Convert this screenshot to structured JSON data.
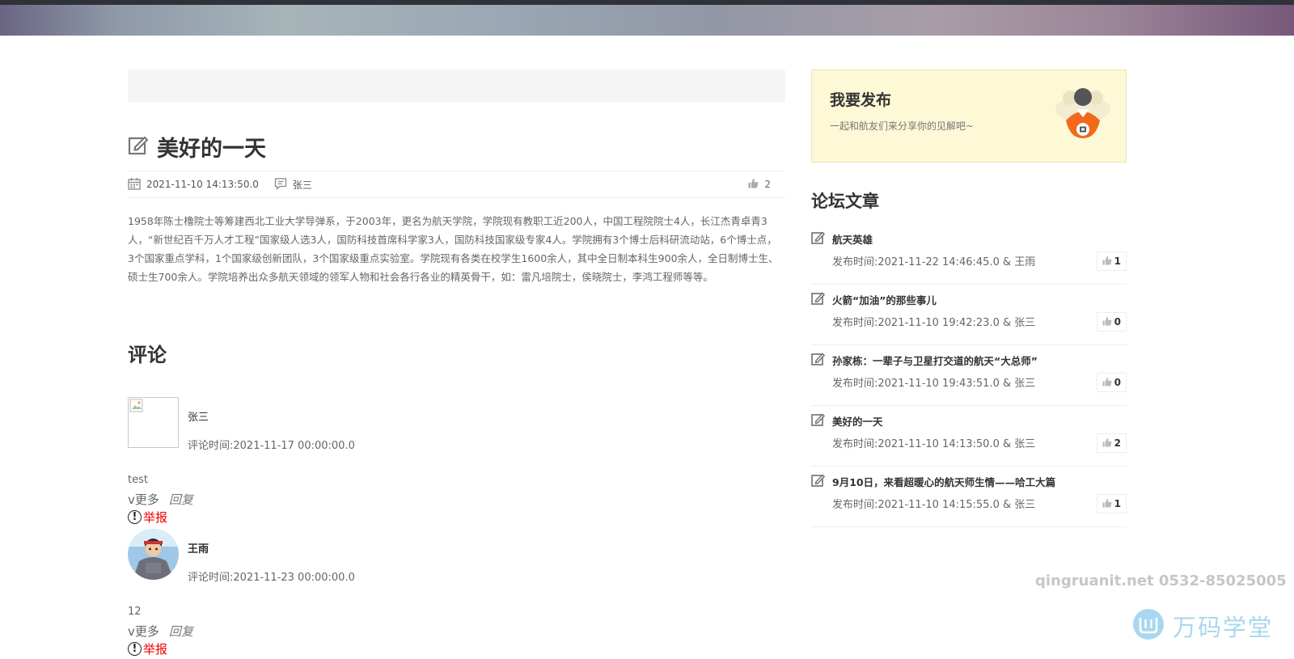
{
  "post": {
    "title": "美好的一天",
    "date": "2021-11-10 14:13:50.0",
    "author": "张三",
    "likes": "2",
    "content": "1958年陈士橹院士等筹建西北工业大学导弹系，于2003年，更名为航天学院，学院现有教职工近200人，中国工程院院士4人，长江杰青卓青3人，“新世纪百千万人才工程”国家级人选3人，国防科技首席科学家3人，国防科技国家级专家4人。学院拥有3个博士后科研流动站，6个博士点，3个国家重点学科，1个国家级创新团队，3个国家级重点实验室。学院现有各类在校学生1600余人，其中全日制本科生900余人，全日制博士生、硕士生700余人。学院培养出众多航天领域的领军人物和社会各行各业的精英骨干，如：雷凡培院士，侯晓院士，李鸿工程师等等。"
  },
  "comments": {
    "heading": "评论",
    "items": [
      {
        "name": "张三",
        "time": "评论时间:2021-11-17 00:00:00.0",
        "text": "test",
        "more_label": "v更多",
        "reply_label": "回复",
        "report_label": "举报"
      },
      {
        "name": "王雨",
        "time": "评论时间:2021-11-23 00:00:00.0",
        "text": "12",
        "more_label": "v更多",
        "reply_label": "回复",
        "report_label": "举报"
      }
    ]
  },
  "publish": {
    "title": "我要发布",
    "subtitle": "一起和航友们来分享你的见解吧~"
  },
  "forum": {
    "heading": "论坛文章",
    "articles": [
      {
        "title": "航天英雄",
        "meta": "发布时间:2021-11-22 14:46:45.0 & 王雨",
        "likes": "1"
      },
      {
        "title": "火箭“加油”的那些事儿",
        "meta": "发布时间:2021-11-10 19:42:23.0 & 张三",
        "likes": "0"
      },
      {
        "title": "孙家栋：一辈子与卫星打交道的航天“大总师”",
        "meta": "发布时间:2021-11-10 19:43:51.0 & 张三",
        "likes": "0"
      },
      {
        "title": "美好的一天",
        "meta": "发布时间:2021-11-10 14:13:50.0 & 张三",
        "likes": "2"
      },
      {
        "title": "9月10日，来看超暖心的航天师生情——哈工大篇",
        "meta": "发布时间:2021-11-10 14:15:55.0 & 张三",
        "likes": "1"
      }
    ]
  },
  "watermark": {
    "contact": "qingruanit.net 0532-85025005",
    "brand": "万码学堂"
  },
  "colors": {
    "report": "#e00000",
    "publish_card_bg": "#fdf8d6",
    "watermark_brand": "#a9d7ef"
  }
}
